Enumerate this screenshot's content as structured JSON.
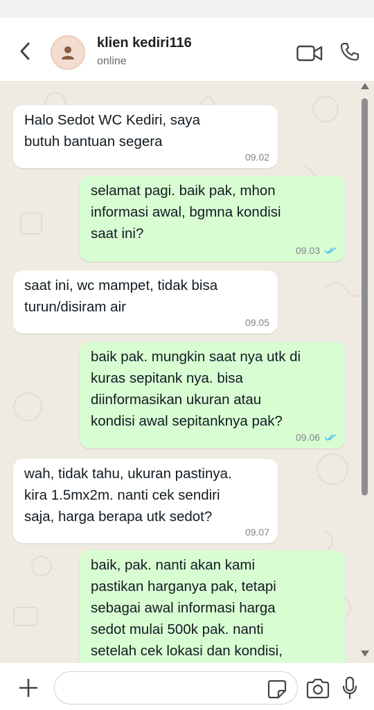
{
  "header": {
    "contact_name": "klien kediri116",
    "status": "online",
    "icons": [
      "back-arrow-icon",
      "avatar-person-icon",
      "video-call-icon",
      "phone-call-icon"
    ]
  },
  "messages": [
    {
      "direction": "incoming",
      "text": "Halo Sedot WC Kediri, saya\nbutuh bantuan segera",
      "time": "09.02"
    },
    {
      "direction": "outgoing",
      "text": "selamat pagi. baik pak, mhon\ninformasi awal, bgmna kondisi\nsaat ini?",
      "time": "09.03",
      "status": "read"
    },
    {
      "direction": "incoming",
      "text": "saat ini, wc mampet, tidak bisa\nturun/disiram air",
      "time": "09.05"
    },
    {
      "direction": "outgoing",
      "text": "baik pak. mungkin saat nya utk di\nkuras sepitank nya. bisa\ndiinformasikan ukuran atau\nkondisi awal sepitanknya pak?",
      "time": "09.06",
      "status": "read"
    },
    {
      "direction": "incoming",
      "text": "wah, tidak tahu, ukuran pastinya.\nkira 1.5mx2m. nanti cek sendiri\nsaja, harga berapa utk sedot?",
      "time": "09.07"
    },
    {
      "direction": "outgoing",
      "text": "baik, pak. nanti akan kami\npastikan harganya pak, tetapi\nsebagai awal informasi harga\nsedot mulai 500k pak. nanti\nsetelah cek lokasi dan kondisi,",
      "time": "",
      "status": ""
    }
  ],
  "composer": {
    "value": "",
    "placeholder": "",
    "icons": [
      "plus-icon",
      "sticker-icon",
      "camera-icon",
      "microphone-icon"
    ]
  },
  "colors": {
    "incoming_bubble": "#ffffff",
    "outgoing_bubble": "#d9fdd3",
    "chat_background": "#efeae2",
    "read_ticks": "#53bdeb"
  }
}
